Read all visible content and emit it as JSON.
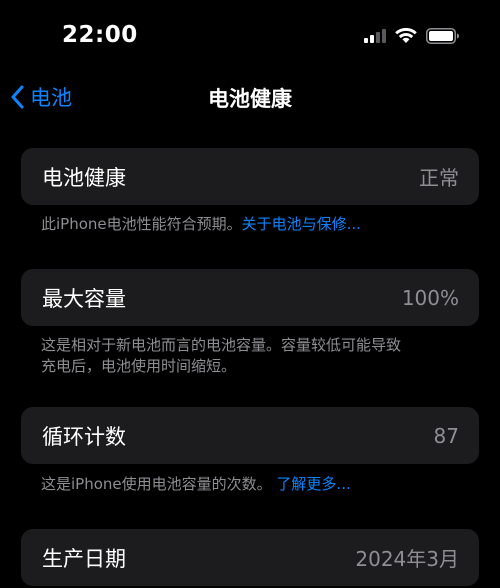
{
  "status_bar": {
    "time": "22:00",
    "icons": [
      "cellular-signal-icon",
      "wifi-icon",
      "battery-icon"
    ]
  },
  "nav": {
    "back_label": "电池",
    "title": "电池健康"
  },
  "rows": [
    {
      "label": "电池健康",
      "value": "正常",
      "note_text": "此iPhone电池性能符合预期。",
      "note_link": "关于电池与保修..."
    },
    {
      "label": "最大容量",
      "value": "100%",
      "note_line1": "这是相对于新电池而言的电池容量。容量较低可能导致",
      "note_line2": "充电后，电池使用时间缩短。"
    },
    {
      "label": "循环计数",
      "value": "87",
      "note_text": "这是iPhone使用电池容量的次数。",
      "note_link": "了解更多..."
    },
    {
      "label": "生产日期",
      "value": "2024年3月"
    }
  ],
  "colors": {
    "background": "#000000",
    "card": "#1c1c1e",
    "accent": "#0a84ff",
    "secondary_text": "#8e8e93"
  }
}
